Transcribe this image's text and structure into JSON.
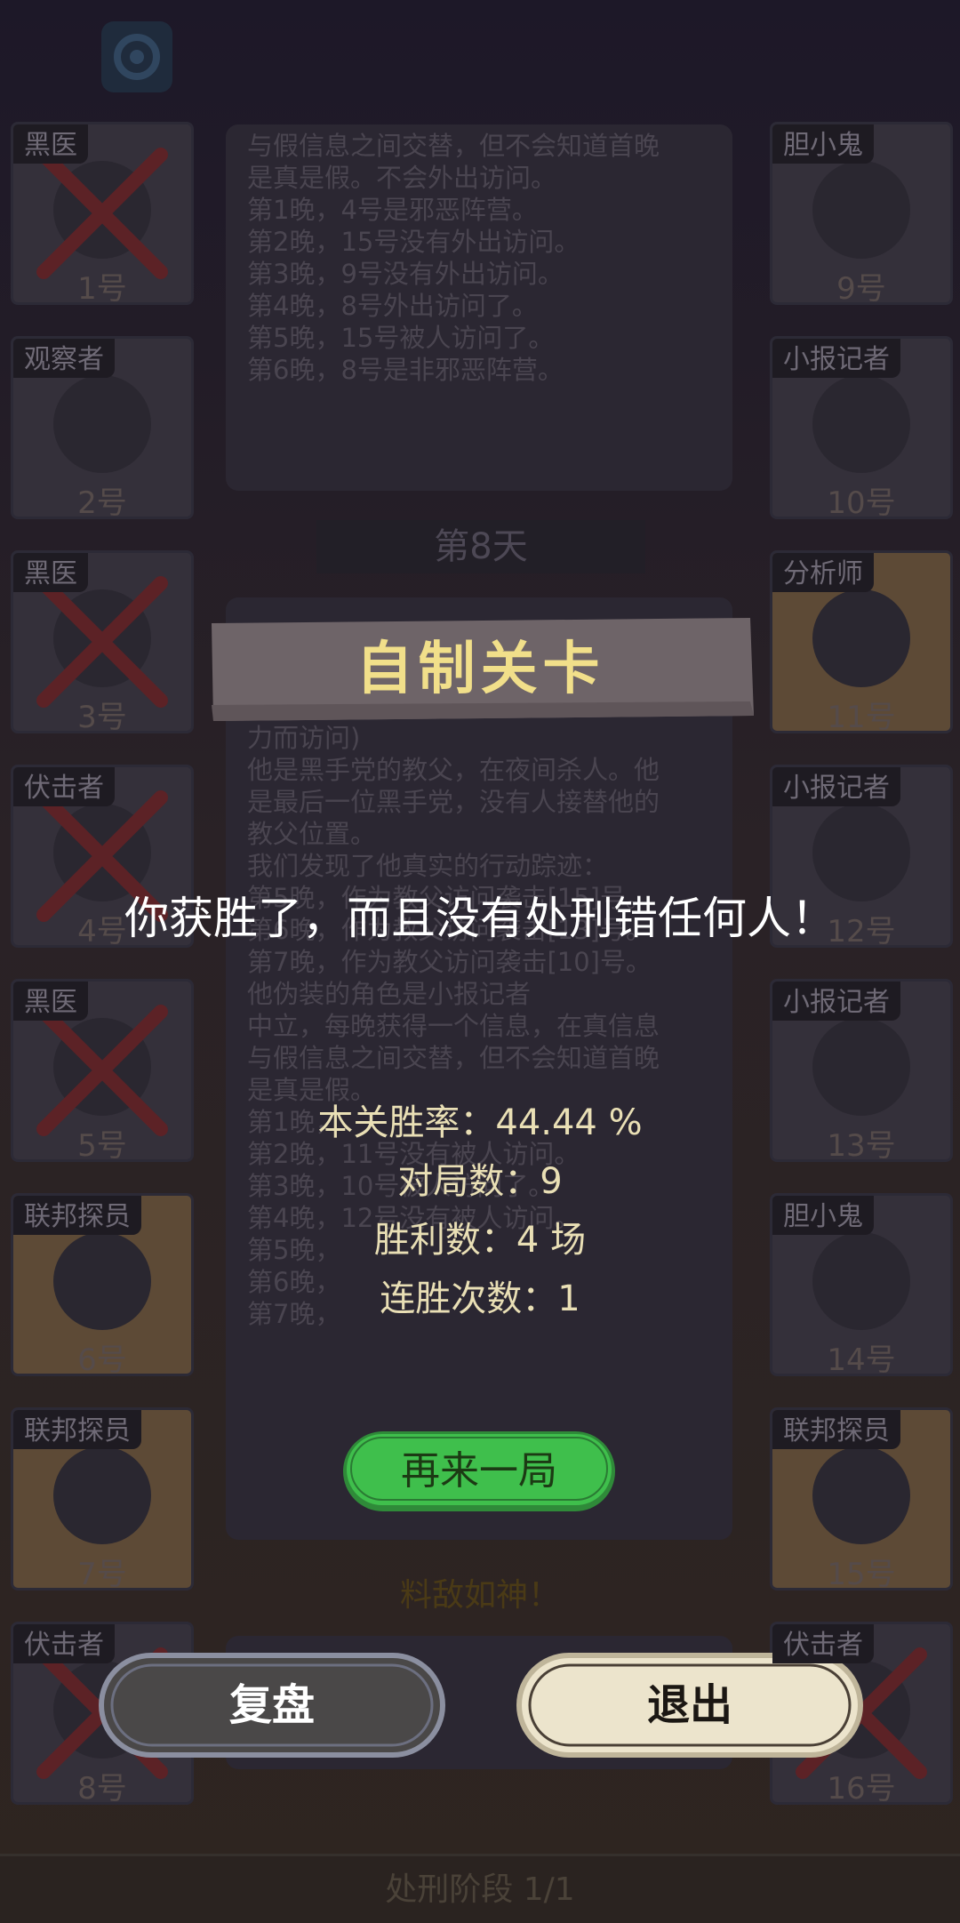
{
  "left_cards": [
    {
      "role": "黑医",
      "num": "1号",
      "dead": true
    },
    {
      "role": "观察者",
      "num": "2号",
      "dead": false
    },
    {
      "role": "黑医",
      "num": "3号",
      "dead": true
    },
    {
      "role": "伏击者",
      "num": "4号",
      "dead": true
    },
    {
      "role": "黑医",
      "num": "5号",
      "dead": true
    },
    {
      "role": "联邦探员",
      "num": "6号",
      "dead": false
    },
    {
      "role": "联邦探员",
      "num": "7号",
      "dead": false
    },
    {
      "role": "伏击者",
      "num": "8号",
      "dead": true
    }
  ],
  "right_cards": [
    {
      "role": "胆小鬼",
      "num": "9号",
      "dead": false
    },
    {
      "role": "小报记者",
      "num": "10号",
      "dead": false
    },
    {
      "role": "分析师",
      "num": "11号",
      "dead": false
    },
    {
      "role": "小报记者",
      "num": "12号",
      "dead": false
    },
    {
      "role": "小报记者",
      "num": "13号",
      "dead": false
    },
    {
      "role": "胆小鬼",
      "num": "14号",
      "dead": false
    },
    {
      "role": "联邦探员",
      "num": "15号",
      "dead": false
    },
    {
      "role": "伏击者",
      "num": "16号",
      "dead": true
    }
  ],
  "panel_top": {
    "lines": [
      "与假信息之间交替，但不会知道首晚",
      "是真是假。不会外出访问。",
      "第1晚，4号是邪恶阵营。",
      "第2晚，15号没有外出访问。",
      "第3晚，9号没有外出访问。",
      "第4晚，8号外出访问了。",
      "第5晚，15号被人访问了。",
      "第6晚，8号是非邪恶阵营。"
    ]
  },
  "day_label": "第8天",
  "panel_mid": {
    "lines": [
      "力而访问)",
      "他是黑手党的教父，在夜间杀人。他",
      "是最后一位黑手党，没有人接替他的",
      "教父位置。",
      "我们发现了他真实的行动踪迹：",
      "第5晚，作为教父访问袭击[15]号。",
      "第6晚，作为教父访问袭击[13]号。",
      "第7晚，作为教父访问袭击[10]号。",
      "他伪装的角色是小报记者",
      "中立，每晚获得一个信息，在真信息",
      "与假信息之间交替，但不会知道首晚",
      "是真是假。",
      "第1晚，",
      "第2晚，11号没有被人访问。",
      "第3晚，10号被人访问了。",
      "第4晚，12号没有被人访问。",
      "第5晚，",
      "第6晚，",
      "第7晚，"
    ]
  },
  "faded_title": "料敌如神！",
  "bottom_bar": "处刑阶段 1/1",
  "banner": "自制关卡",
  "result_message": "你获胜了，而且没有处刑错任何人！",
  "stats": {
    "win_rate": "本关胜率：44.44 %",
    "games": "对局数：9",
    "wins": "胜利数：4 场",
    "streak": "连胜次数：1"
  },
  "buttons": {
    "play_again": "再来一局",
    "review": "复盘",
    "exit": "退出"
  },
  "colors": {
    "banner_bg": "#6e6468",
    "banner_text": "#f1df8a",
    "play_again_bg": "#3fbf4c",
    "review_bg": "#4a4848",
    "exit_bg": "#ece4cc"
  }
}
